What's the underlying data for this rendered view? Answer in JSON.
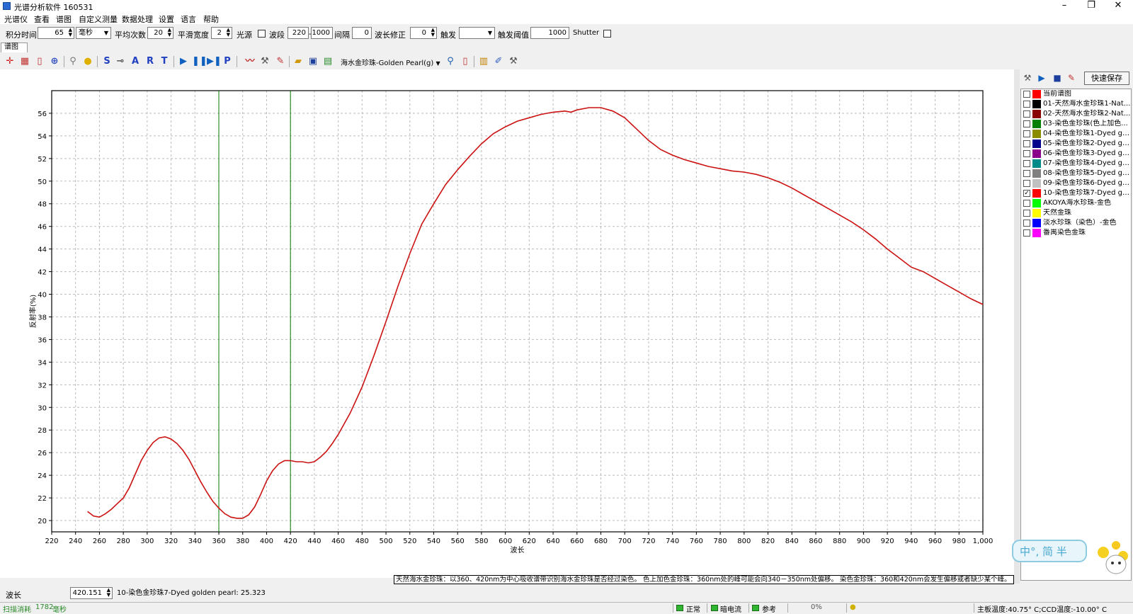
{
  "window": {
    "title": "光谱分析软件 160531",
    "minimize": "–",
    "maximize": "❐",
    "close": "✕"
  },
  "menu": [
    "光谱仪",
    "查看",
    "谱图",
    "自定义测量",
    "数据处理",
    "设置",
    "语言",
    "帮助"
  ],
  "controls": {
    "integration_time_label": "积分时间",
    "integration_time_value": "65",
    "unit_value": "毫秒",
    "average_label": "平均次数",
    "average_value": "20",
    "smooth_label": "平滑宽度",
    "smooth_value": "2",
    "light_label": "光源",
    "band_label": "波段",
    "band_start": "220",
    "band_dash": "-",
    "band_end": "1000",
    "interval_label": "间隔",
    "interval_value": "0",
    "wl_correct_label": "波长修正",
    "wl_correct_value": "0",
    "trigger_label": "触发",
    "trigger_value": "",
    "threshold_label": "触发阈值",
    "threshold_value": "1000",
    "shutter_label": "Shutter"
  },
  "tab": {
    "label": "谱图"
  },
  "toolbar": {
    "letters": [
      "S",
      "A",
      "R",
      "T",
      "P"
    ],
    "sample_select": "海水金珍珠-Golden Pearl(g)"
  },
  "right_panel": {
    "quick_save": "快速保存"
  },
  "legend": [
    {
      "name": "当前谱图",
      "color": "#ff0000",
      "checked": false
    },
    {
      "name": "01-天然海水金珍珠1-Nat...",
      "color": "#000000",
      "checked": false
    },
    {
      "name": "02-天然海水金珍珠2-Nat...",
      "color": "#8b0000",
      "checked": false
    },
    {
      "name": "03-染色金珍珠(色上加色...",
      "color": "#008000",
      "checked": false
    },
    {
      "name": "04-染色金珍珠1-Dyed go...",
      "color": "#8b8b00",
      "checked": false
    },
    {
      "name": "05-染色金珍珠2-Dyed go...",
      "color": "#00008b",
      "checked": false
    },
    {
      "name": "06-染色金珍珠3-Dyed go...",
      "color": "#8b008b",
      "checked": false
    },
    {
      "name": "07-染色金珍珠4-Dyed go...",
      "color": "#008b8b",
      "checked": false
    },
    {
      "name": "08-染色金珍珠5-Dyed go...",
      "color": "#808080",
      "checked": false
    },
    {
      "name": "09-染色金珍珠6-Dyed go...",
      "color": "#c0c0c0",
      "checked": false
    },
    {
      "name": "10-染色金珍珠7-Dyed go...",
      "color": "#ff0000",
      "checked": true
    },
    {
      "name": "AKOYA海水珍珠-金色",
      "color": "#00ff00",
      "checked": false
    },
    {
      "name": "天然金珠",
      "color": "#ffff00",
      "checked": false
    },
    {
      "name": "淡水珍珠（染色）-金色",
      "color": "#0000ff",
      "checked": false
    },
    {
      "name": "番禺染色金珠",
      "color": "#ff00ff",
      "checked": false
    }
  ],
  "chart_data": {
    "type": "line",
    "title": "",
    "xlabel": "波长",
    "ylabel": "反射率(%)",
    "xlim": [
      220,
      1000
    ],
    "ylim": [
      19,
      58
    ],
    "x_ticks": [
      220,
      240,
      260,
      280,
      300,
      320,
      340,
      360,
      380,
      400,
      420,
      440,
      460,
      480,
      500,
      520,
      540,
      560,
      580,
      600,
      620,
      640,
      660,
      680,
      700,
      720,
      740,
      760,
      780,
      800,
      820,
      840,
      860,
      880,
      900,
      920,
      940,
      960,
      980,
      1000
    ],
    "x_tick_labels": [
      "220",
      "240",
      "260",
      "280",
      "300",
      "320",
      "340",
      "360",
      "380",
      "400",
      "420",
      "440",
      "460",
      "480",
      "500",
      "520",
      "540",
      "560",
      "580",
      "600",
      "620",
      "640",
      "660",
      "680",
      "700",
      "720",
      "740",
      "760",
      "780",
      "800",
      "820",
      "840",
      "860",
      "880",
      "900",
      "920",
      "940",
      "960",
      "980",
      "1,000"
    ],
    "y_ticks": [
      20,
      22,
      24,
      26,
      28,
      30,
      32,
      34,
      36,
      38,
      40,
      42,
      44,
      46,
      48,
      50,
      52,
      54,
      56
    ],
    "grid": true,
    "markers": [
      360,
      420
    ],
    "series": [
      {
        "color": "#cc1111",
        "x": [
          250,
          255,
          260,
          265,
          270,
          275,
          280,
          285,
          290,
          295,
          300,
          305,
          310,
          315,
          320,
          325,
          330,
          335,
          340,
          345,
          350,
          355,
          360,
          365,
          370,
          375,
          380,
          385,
          390,
          395,
          400,
          405,
          410,
          415,
          420,
          425,
          430,
          435,
          440,
          445,
          450,
          455,
          460,
          470,
          480,
          490,
          500,
          510,
          520,
          530,
          540,
          550,
          560,
          570,
          580,
          590,
          600,
          610,
          620,
          630,
          640,
          650,
          655,
          660,
          670,
          680,
          690,
          700,
          710,
          720,
          730,
          740,
          750,
          760,
          770,
          780,
          790,
          800,
          810,
          820,
          830,
          840,
          850,
          860,
          870,
          880,
          890,
          900,
          910,
          920,
          930,
          940,
          950,
          960,
          970,
          980,
          990,
          1000
        ],
        "y": [
          20.8,
          20.4,
          20.3,
          20.6,
          21.0,
          21.5,
          22.0,
          22.9,
          24.1,
          25.3,
          26.2,
          26.9,
          27.3,
          27.4,
          27.2,
          26.8,
          26.2,
          25.4,
          24.4,
          23.4,
          22.5,
          21.7,
          21.1,
          20.6,
          20.3,
          20.2,
          20.2,
          20.5,
          21.2,
          22.3,
          23.5,
          24.4,
          25.0,
          25.3,
          25.3,
          25.2,
          25.2,
          25.1,
          25.2,
          25.6,
          26.1,
          26.8,
          27.6,
          29.5,
          31.8,
          34.6,
          37.6,
          40.7,
          43.6,
          46.2,
          48.0,
          49.7,
          51.0,
          52.2,
          53.3,
          54.2,
          54.8,
          55.3,
          55.6,
          55.9,
          56.1,
          56.2,
          56.1,
          56.3,
          56.5,
          56.5,
          56.2,
          55.6,
          54.6,
          53.6,
          52.8,
          52.3,
          51.9,
          51.6,
          51.3,
          51.1,
          50.9,
          50.8,
          50.6,
          50.3,
          49.9,
          49.4,
          48.8,
          48.2,
          47.6,
          47.0,
          46.4,
          45.7,
          44.9,
          44.0,
          43.2,
          42.4,
          42.0,
          41.4,
          40.8,
          40.2,
          39.6,
          39.1
        ]
      }
    ]
  },
  "bottom": {
    "wave_label": "波长",
    "wave_value": "420.151",
    "readout": "10-染色金珍珠7-Dyed golden pearl: 25.323",
    "note": "天然海水金珍珠：以360、420nm为中心吸收谱带识别海水金珍珠是否经过染色。 色上加色金珍珠：360nm处的峰可能会向340－350nm处偏移。 染色金珍珠：360和420nm会发生偏移或者缺少某个峰。"
  },
  "mascot": {
    "text": "中°, 简 半"
  },
  "status": {
    "scan_label": "扫描消耗",
    "scan_value": "1782",
    "scan_unit": "毫秒",
    "normal": "正常",
    "dark": "暗电流",
    "ref": "参考",
    "progress": "0%",
    "temp": "主板温度:40.75° C;CCD温度:-10.00° C"
  }
}
